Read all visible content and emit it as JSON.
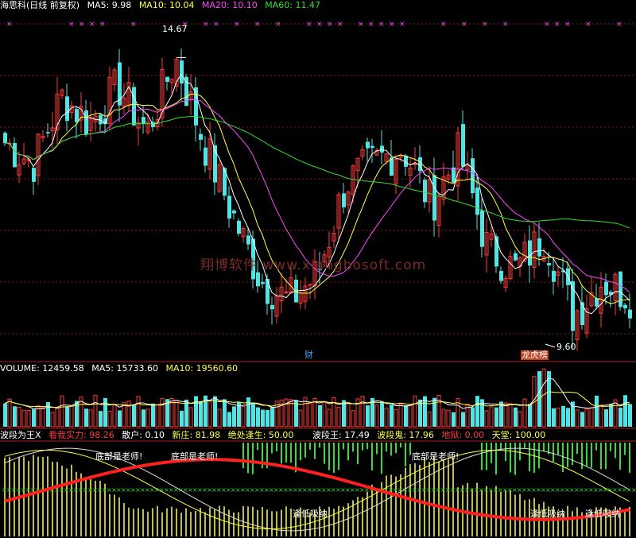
{
  "colors": {
    "bg": "#000000",
    "up": "#ff3a3a",
    "down": "#4fe5e5",
    "ma5": "#ffffff",
    "ma10": "#ffff4a",
    "ma20": "#ff4aff",
    "ma60": "#33dd33",
    "grid": "#8a1a1a",
    "watermark": "#7a2a2a"
  },
  "price_header": {
    "title": "海思科(日线 前复权)",
    "ma5": "MA5: 9.98",
    "ma10": "MA10: 10.04",
    "ma20": "MA20: 10.10",
    "ma60": "MA60: 11.47"
  },
  "annotations": {
    "high": "14.67",
    "low": "9.60",
    "marker_cai": "财",
    "marker_bang": "龙虎榜",
    "watermark": "翔博软件  www.xiangbosoft.com"
  },
  "volume_header": {
    "volume": "VOLUME: 12459.58",
    "ma5": "MA5: 15733.60",
    "ma10": "MA10: 19560.60"
  },
  "indicator_header": {
    "name": "波段为王X",
    "kanwo": "看我实力: 98.26",
    "sanhu": "散户: 0.10",
    "xinzhuang": "新庄: 81.98",
    "juechu": "绝处逢生: 50.00",
    "boduanwang": "波段王: 17.49",
    "boduangui": "波段鬼: 17.96",
    "diyu": "地狱: 0.00",
    "tiantang": "天堂: 100.00"
  },
  "indicator_labels": {
    "dixiao": "底部是老师!",
    "fengdi": "逢低吸纳"
  },
  "chart_data": [
    {
      "type": "candlestick",
      "title": "海思科(日线 前复权)",
      "series": [
        {
          "name": "MA5",
          "last": 9.98
        },
        {
          "name": "MA10",
          "last": 10.04
        },
        {
          "name": "MA20",
          "last": 10.1
        },
        {
          "name": "MA60",
          "last": 11.47
        }
      ],
      "marked_high": 14.67,
      "marked_low": 9.6,
      "close_path_key_points": [
        13.0,
        12.6,
        13.9,
        13.4,
        14.1,
        13.2,
        14.67,
        13.0,
        11.6,
        10.3,
        9.9,
        10.4,
        12.2,
        12.6,
        12.9,
        11.8,
        12.8,
        10.9,
        10.5,
        11.2,
        9.6,
        10.3,
        10.0
      ]
    },
    {
      "type": "bar",
      "title": "VOLUME",
      "series": [
        {
          "name": "VOLUME",
          "last": 12459.58
        },
        {
          "name": "MA5",
          "last": 15733.6
        },
        {
          "name": "MA10",
          "last": 19560.6
        }
      ]
    },
    {
      "type": "line",
      "title": "波段为王X",
      "series": [
        {
          "name": "看我实力",
          "last": 98.26
        },
        {
          "name": "散户",
          "last": 0.1
        },
        {
          "name": "新庄",
          "last": 81.98
        },
        {
          "name": "绝处逢生",
          "last": 50.0
        },
        {
          "name": "波段王",
          "last": 17.49
        },
        {
          "name": "波段鬼",
          "last": 17.96
        },
        {
          "name": "地狱",
          "last": 0.0
        },
        {
          "name": "天堂",
          "last": 100.0
        }
      ]
    }
  ]
}
